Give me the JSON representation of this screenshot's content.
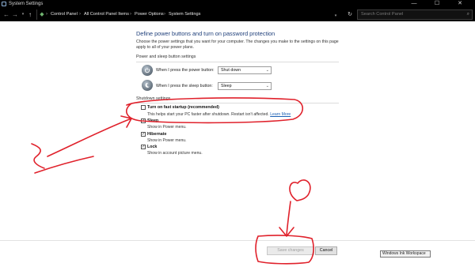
{
  "window": {
    "title": "System Settings",
    "controls": {
      "minimize": "—",
      "maximize": "☐",
      "close": "✕"
    }
  },
  "address_bar": {
    "back_icon": "arrow-left",
    "forward_icon": "arrow-right",
    "recent_icon": "chevron-down",
    "up_icon": "arrow-up",
    "breadcrumbs": [
      "Control Panel",
      "All Control Panel Items",
      "Power Options",
      "System Settings"
    ],
    "refresh_icon": "refresh",
    "search_placeholder": "Search Control Panel"
  },
  "main": {
    "heading": "Define power buttons and turn on password protection",
    "description": "Choose the power settings that you want for your computer. The changes you make to the settings on this page apply to all of your power plans.",
    "power_group_label": "Power and sleep button settings",
    "power_button": {
      "label": "When I press the power button:",
      "value": "Shut down"
    },
    "sleep_button": {
      "label": "When I press the sleep button:",
      "value": "Sleep"
    },
    "shutdown_group_label": "Shutdown settings",
    "options": [
      {
        "title": "Turn on fast startup (recommended)",
        "desc": "This helps start your PC faster after shutdown. Restart isn't affected.",
        "link": "Learn More",
        "checked": false
      },
      {
        "title": "Sleep",
        "desc": "Show in Power menu.",
        "checked": true
      },
      {
        "title": "Hibernate",
        "desc": "Show in Power menu.",
        "checked": true
      },
      {
        "title": "Lock",
        "desc": "Show in account picture menu.",
        "checked": true
      }
    ]
  },
  "footer": {
    "save_label": "Save changes",
    "cancel_label": "Cancel",
    "ink_tooltip": "Windows Ink Workspace"
  },
  "colors": {
    "ink_red": "#e0212b",
    "heading_blue": "#1f3f7a",
    "link_blue": "#1a5fb4"
  }
}
